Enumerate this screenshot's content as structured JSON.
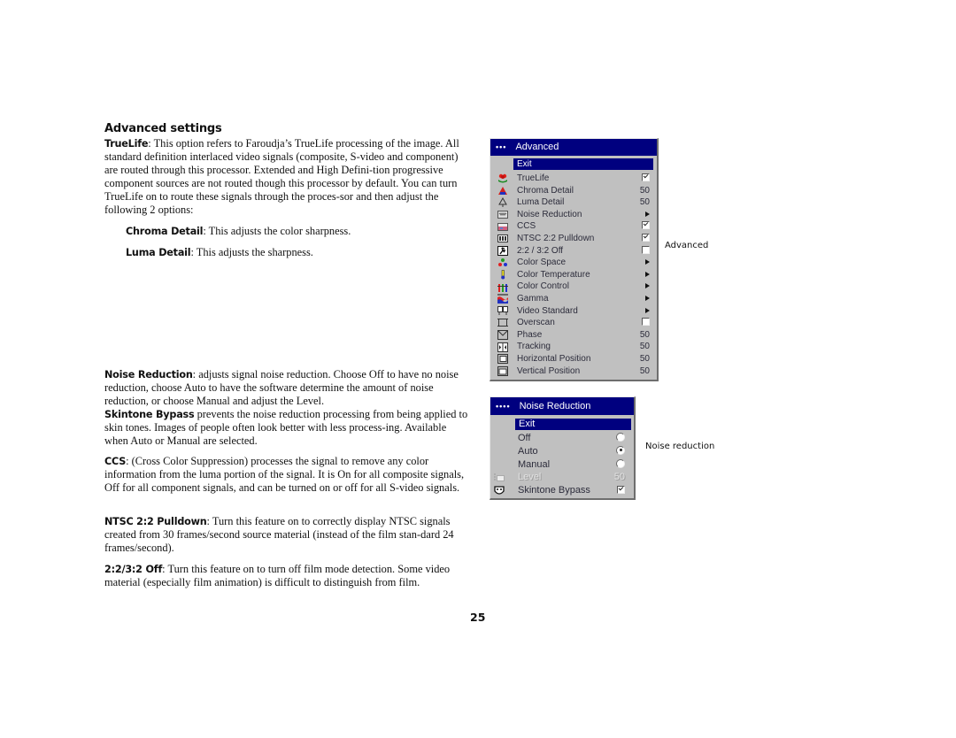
{
  "heading": "Advanced settings",
  "paragraphs": {
    "truelife": {
      "term": "TrueLife",
      "text": ": This option refers to Faroudja’s TrueLife processing of the image. All standard definition interlaced video signals (composite, S-video and component) are routed through this processor.  Extended and High Defini-tion progressive component sources are not routed though this processor by default.  You can turn TrueLife on to route these signals through the proces-sor and then adjust the following 2 options:"
    },
    "chroma_detail": {
      "term": "Chroma Detail",
      "text": ": This adjusts the color sharpness."
    },
    "luma_detail": {
      "term": "Luma Detail",
      "text": ": This adjusts the sharpness."
    },
    "noise_reduction": {
      "term": "Noise Reduction",
      "text": ": adjusts signal noise reduction. Choose Off to have no noise reduction, choose Auto to have the software determine the amount of noise reduction, or choose Manual and adjust the Level."
    },
    "skintone_bypass": {
      "term": "Skintone Bypass",
      "text": " prevents the noise reduction processing from being applied to skin tones. Images of people often look better with less process-ing. Available when Auto or Manual are selected."
    },
    "ccs": {
      "term": "CCS",
      "text": ": (Cross Color Suppression) processes the signal to remove any color information from the luma portion of the signal. It is On for all composite signals, Off for all component signals, and can be turned on or off for all S-video signals."
    },
    "ntsc": {
      "term": "NTSC 2:2 Pulldown",
      "text": ": Turn this feature on to correctly display NTSC signals created from 30 frames/second source material (instead of the film stan-dard 24 frames/second)."
    },
    "film_off": {
      "term": "2:2/3:2 Off",
      "text": ": Turn this feature on to turn off film mode detection. Some video material (especially film animation) is difficult to distinguish from film."
    }
  },
  "page_number": "25",
  "captions": {
    "advanced": "Advanced",
    "noise_reduction": "Noise reduction"
  },
  "advanced_menu": {
    "title_dots": "•••",
    "title": "Advanced",
    "exit": "Exit",
    "items": [
      {
        "label": "TrueLife",
        "icon": "truelife-icon",
        "control": "checkbox",
        "checked": true
      },
      {
        "label": "Chroma Detail",
        "icon": "chroma-detail-icon",
        "control": "value",
        "value": "50"
      },
      {
        "label": "Luma Detail",
        "icon": "luma-detail-icon",
        "control": "value",
        "value": "50"
      },
      {
        "label": "Noise Reduction",
        "icon": "noise-reduction-icon",
        "control": "submenu"
      },
      {
        "label": "CCS",
        "icon": "ccs-icon",
        "control": "checkbox",
        "checked": true
      },
      {
        "label": "NTSC 2:2 Pulldown",
        "icon": "ntsc-pulldown-icon",
        "control": "checkbox",
        "checked": true
      },
      {
        "label": "2:2 / 3:2 Off",
        "icon": "film-mode-icon",
        "control": "checkbox",
        "checked": false
      },
      {
        "label": "Color Space",
        "icon": "color-space-icon",
        "control": "submenu"
      },
      {
        "label": "Color Temperature",
        "icon": "color-temperature-icon",
        "control": "submenu"
      },
      {
        "label": "Color Control",
        "icon": "color-control-icon",
        "control": "submenu"
      },
      {
        "label": "Gamma",
        "icon": "gamma-icon",
        "control": "submenu"
      },
      {
        "label": "Video Standard",
        "icon": "video-standard-icon",
        "control": "submenu"
      },
      {
        "label": "Overscan",
        "icon": "overscan-icon",
        "control": "checkbox",
        "checked": false
      },
      {
        "label": "Phase",
        "icon": "phase-icon",
        "control": "value",
        "value": "50"
      },
      {
        "label": "Tracking",
        "icon": "tracking-icon",
        "control": "value",
        "value": "50"
      },
      {
        "label": "Horizontal Position",
        "icon": "horizontal-position-icon",
        "control": "value",
        "value": "50"
      },
      {
        "label": "Vertical Position",
        "icon": "vertical-position-icon",
        "control": "value",
        "value": "50"
      }
    ]
  },
  "noise_menu": {
    "title_dots": "••••",
    "title": "Noise Reduction",
    "exit": "Exit",
    "items": [
      {
        "label": "Off",
        "control": "radio",
        "selected": false
      },
      {
        "label": "Auto",
        "control": "radio",
        "selected": true
      },
      {
        "label": "Manual",
        "control": "radio",
        "selected": false
      },
      {
        "label": "Level",
        "icon": "level-icon",
        "control": "value",
        "value": "50",
        "disabled": true
      },
      {
        "label": "Skintone Bypass",
        "icon": "skintone-bypass-icon",
        "control": "checkbox",
        "checked": true
      }
    ]
  }
}
